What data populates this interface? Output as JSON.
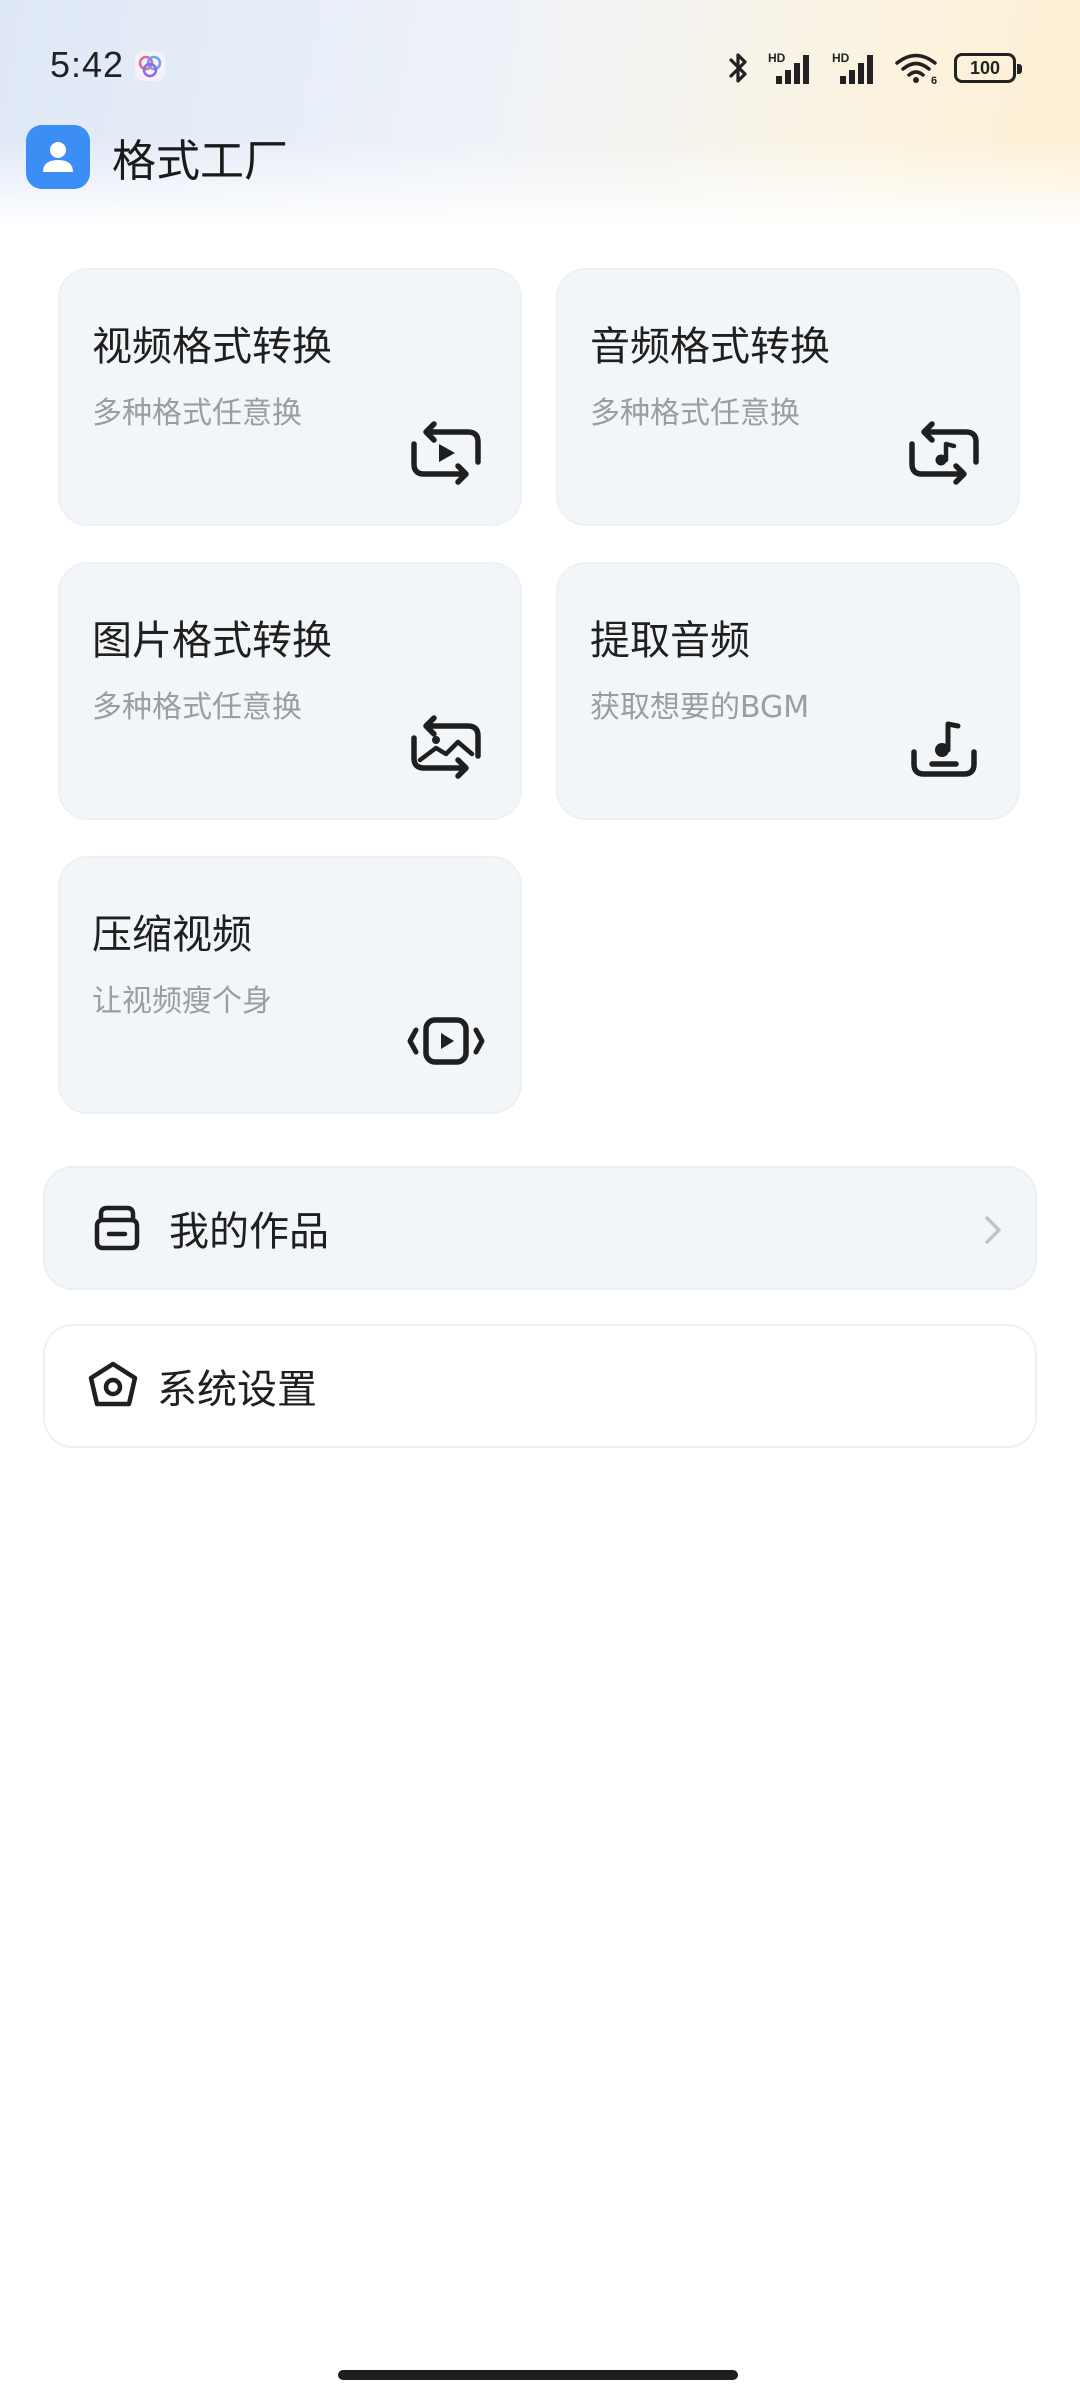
{
  "status_bar": {
    "time": "5:42",
    "battery": "100",
    "network_1": "HD",
    "network_2": "HD",
    "wifi_badge": "6",
    "icons": [
      "bluetooth-icon",
      "signal-hd-icon",
      "signal-hd-icon",
      "wifi-6-icon",
      "battery-icon"
    ]
  },
  "app": {
    "title": "格式工厂",
    "logo_icon": "user-avatar-icon",
    "accent": "#3a8ef6"
  },
  "cards": [
    {
      "title": "视频格式转换",
      "subtitle": "多种格式任意换",
      "icon": "video-convert-icon"
    },
    {
      "title": "音频格式转换",
      "subtitle": "多种格式任意换",
      "icon": "audio-convert-icon"
    },
    {
      "title": "图片格式转换",
      "subtitle": "多种格式任意换",
      "icon": "image-convert-icon"
    },
    {
      "title": "提取音频",
      "subtitle": "获取想要的BGM",
      "icon": "extract-audio-icon"
    },
    {
      "title": "压缩视频",
      "subtitle": "让视频瘦个身",
      "icon": "compress-video-icon"
    }
  ],
  "menu": {
    "works_label": "我的作品",
    "works_icon": "inbox-icon",
    "settings_label": "系统设置",
    "settings_icon": "settings-pentagon-icon"
  }
}
